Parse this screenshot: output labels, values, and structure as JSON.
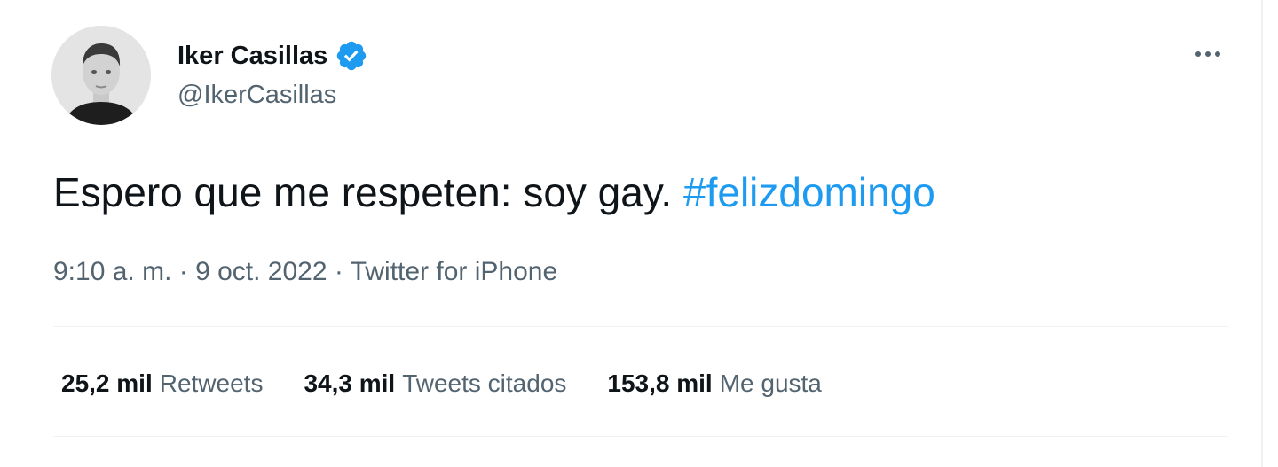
{
  "author": {
    "display_name": "Iker Casillas",
    "handle": "@IkerCasillas",
    "verified": true,
    "verified_color": "#1d9bf0"
  },
  "icons": {
    "verified": "verified-badge-icon",
    "more": "more-horizontal-icon"
  },
  "tweet": {
    "text": "Espero que me respeten: soy gay.",
    "hashtag": "#felizdomingo",
    "hashtag_color": "#1d9bf0"
  },
  "meta": {
    "time": "9:10 a. m.",
    "separator": "·",
    "date": "9 oct. 2022",
    "source": "Twitter for iPhone"
  },
  "stats": [
    {
      "count": "25,2 mil",
      "label": "Retweets"
    },
    {
      "count": "34,3 mil",
      "label": "Tweets citados"
    },
    {
      "count": "153,8 mil",
      "label": "Me gusta"
    }
  ]
}
